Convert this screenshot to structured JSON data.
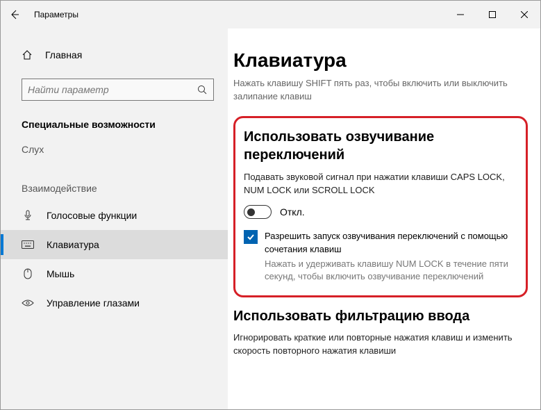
{
  "titlebar": {
    "title": "Параметры"
  },
  "sidebar": {
    "home": "Главная",
    "search_placeholder": "Найти параметр",
    "category": "Специальные возможности",
    "sub1": "Слух",
    "sub2": "Взаимодействие",
    "items": [
      {
        "label": "Голосовые функции"
      },
      {
        "label": "Клавиатура"
      },
      {
        "label": "Мышь"
      },
      {
        "label": "Управление глазами"
      }
    ]
  },
  "main": {
    "heading": "Клавиатура",
    "sub": "Нажать клавишу SHIFT пять раз, чтобы включить или выключить залипание клавиш",
    "sec1": {
      "title": "Использовать озвучивание переключений",
      "desc": "Подавать звуковой сигнал при нажатии клавиши CAPS LOCK, NUM LOCK или SCROLL LOCK",
      "toggle_label": "Откл.",
      "check_label": "Разрешить запуск озвучивания переключений с помощью сочетания клавиш",
      "check_hint": "Нажать и удерживать клавишу NUM LOCK в течение пяти секунд, чтобы включить озвучивание переключений"
    },
    "sec2": {
      "title": "Использовать фильтрацию ввода",
      "desc": "Игнорировать краткие или повторные нажатия клавиш и изменить скорость повторного нажатия клавиши"
    }
  }
}
